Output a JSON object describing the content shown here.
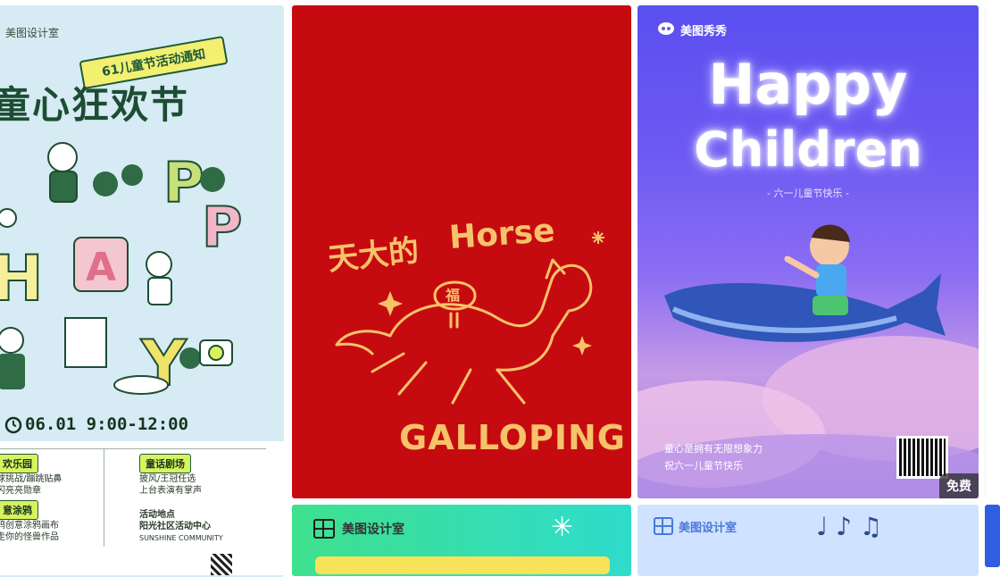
{
  "cards": [
    {
      "brand": "美图设计室",
      "ribbon": "61儿童节活动通知",
      "title": "童心狂欢节",
      "letters": [
        "P",
        "P",
        "A",
        "Y",
        "H"
      ],
      "time": "06.01  9:00-12:00",
      "left_sections": [
        {
          "tag": "欢乐园",
          "lines": [
            "球挑战/蹦跳贴鼻",
            "闪亮亮勋章"
          ]
        },
        {
          "tag": "意涂鸦",
          "lines": [
            "鸦创意涂鸦画布",
            "走你的怪兽作品"
          ]
        }
      ],
      "right_sections": [
        {
          "tag": "童话剧场",
          "lines": [
            "披风/王冠任选",
            "上台表演有掌声"
          ]
        }
      ],
      "location": {
        "label": "活动地点",
        "name": "阳光社区活动中心",
        "en": "SUNSHINE COMMUNITY"
      }
    },
    {
      "text_cn": "天大的",
      "text_en": "Horse",
      "char": "福",
      "text_bottom": "GALLOPING"
    },
    {
      "brand": "美图秀秀",
      "title_line1": "Happy",
      "title_line2": "Children",
      "subtitle": "- 六一儿童节快乐 -",
      "blurb_line1": "童心是拥有无限想象力",
      "blurb_line2": "祝六一儿童节快乐",
      "badge": "免费"
    },
    {
      "brand": "美图设计室"
    },
    {
      "brand": "美图设计室"
    }
  ],
  "colors": {
    "red": "#c60b10",
    "gold": "#f6c26a",
    "green_dark": "#1d4d33",
    "lime": "#d9f25e",
    "purple": "#6d59f3"
  }
}
